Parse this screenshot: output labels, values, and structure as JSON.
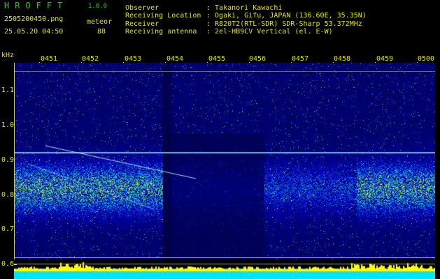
{
  "header": {
    "app_logo": "HROFFT",
    "app_version": "1.0.0",
    "file_name": "2505200450.png",
    "datetime": "25.05.20 04:50",
    "mode_label": "meteor",
    "count": "88",
    "fields": [
      {
        "label": "Observer",
        "value": ": Takanori Kawachi"
      },
      {
        "label": "Receiving Location",
        "value": ": Ogaki, Gifu, JAPAN (136.60E, 35.35N)"
      },
      {
        "label": "Receiver",
        "value": ": R820T2(RTL-SDR) SDR-Sharp 53.372MHz"
      },
      {
        "label": "Receiving antenna",
        "value": ": 2el-HB9CV Vertical (el. E-W)"
      }
    ]
  },
  "axes": {
    "y_unit": "kHz",
    "y_ticks": [
      "1.1",
      "1.0",
      "0.9",
      "0.8",
      "0.7",
      "0.6"
    ],
    "x_ticks": [
      "0451",
      "0452",
      "0453",
      "0454",
      "0455",
      "0456",
      "0457",
      "0458",
      "0459",
      "0500"
    ]
  },
  "colors": {
    "background": "#000000",
    "text_green": "#1bd11b",
    "text_yellow": "#e6e600",
    "spectrum_low": "#000060",
    "spectrum_high": "#ffff00",
    "amplitude_fill": "#00e5ff"
  }
}
